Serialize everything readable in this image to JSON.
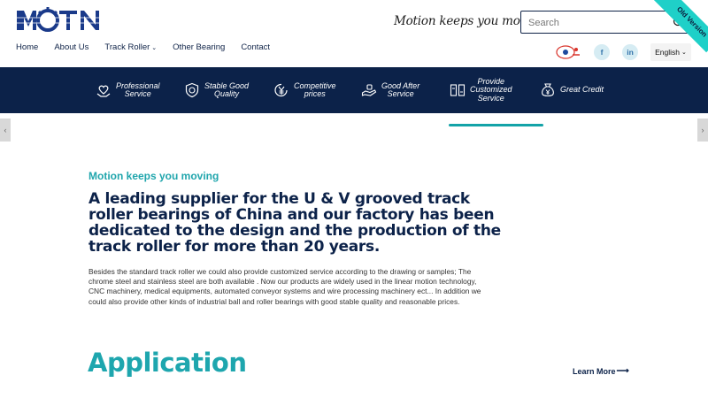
{
  "header": {
    "logo_text": "MOTN",
    "slogan": "Motion keeps you moving",
    "search_placeholder": "Search",
    "ribbon": "Old Version",
    "nav": [
      {
        "label": "Home"
      },
      {
        "label": "About Us"
      },
      {
        "label": "Track Roller",
        "dropdown": true
      },
      {
        "label": "Other Bearing"
      },
      {
        "label": "Contact"
      }
    ],
    "social": {
      "facebook": "f",
      "linkedin": "in"
    },
    "language": "English"
  },
  "features": [
    {
      "label": "Professional\nService",
      "icon": "handshake-heart-icon"
    },
    {
      "label": "Stable Good\nQuality",
      "icon": "shield-check-icon"
    },
    {
      "label": "Competitive\nprices",
      "icon": "yen-coin-icon"
    },
    {
      "label": "Good After\nService",
      "icon": "hand-care-icon"
    },
    {
      "label": "Provide\nCustomized\nService",
      "icon": "customize-icon"
    },
    {
      "label": "Great Credit",
      "icon": "money-bag-icon"
    }
  ],
  "slider": {
    "prev": "‹",
    "next": "›"
  },
  "about": {
    "tagline": "Motion keeps you moving",
    "headline": "A leading supplier for the U & V grooved track roller bearings of China and our factory has been dedicated to the design and the production of the track roller for more than 20 years.",
    "description": "Besides the standard track roller we could also provide customized service according to the drawing or samples; The chrome steel and stainless steel are both available . Now our products are widely used in the linear motion technology, CNC machinery, medical equipments, automated conveyor systems and wire processing machinery ect... In addition we could also provide other kinds of industrial ball and roller bearings with good stable quality and reasonable prices."
  },
  "application": {
    "title": "Application",
    "more": "Learn More"
  },
  "colors": {
    "navy": "#0c2249",
    "teal": "#21a6ad",
    "ribbon": "#1fd0c8"
  }
}
